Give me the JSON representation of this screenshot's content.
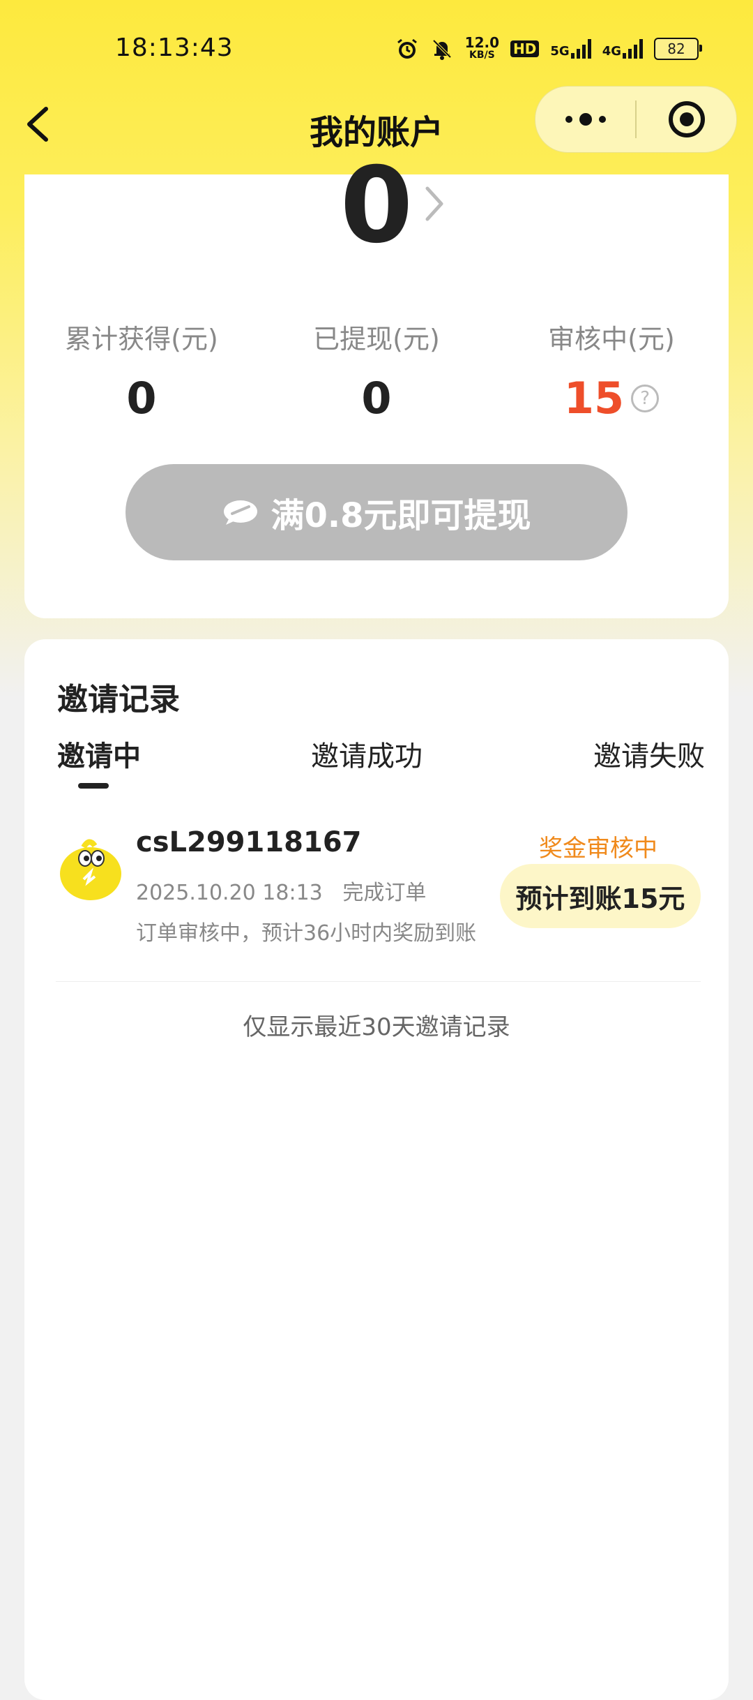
{
  "status_bar": {
    "time": "18:13:43",
    "speed_value": "12.0",
    "speed_unit": "KB/S",
    "hd_label": "HD",
    "net1": "5G",
    "net2": "4G",
    "battery": "82",
    "icons": [
      "alarm-icon",
      "mute-bell-icon",
      "signal-icon",
      "battery-icon"
    ]
  },
  "nav": {
    "title": "我的账户",
    "back_icon": "chevron-left-icon",
    "more_icon": "more-dots-icon",
    "close_icon": "target-icon"
  },
  "account": {
    "balance": "0",
    "stats": [
      {
        "label": "累计获得(元)",
        "value": "0"
      },
      {
        "label": "已提现(元)",
        "value": "0"
      },
      {
        "label": "审核中(元)",
        "value": "15"
      }
    ],
    "help_icon_text": "?",
    "withdraw_label": "满0.8元即可提现",
    "colors": {
      "pending": "#ee4e2a",
      "button_disabled": "#bababa"
    }
  },
  "invites": {
    "section_title": "邀请记录",
    "tabs": [
      {
        "label": "邀请中",
        "active": true
      },
      {
        "label": "邀请成功",
        "active": false
      },
      {
        "label": "邀请失败",
        "active": false
      }
    ],
    "records": [
      {
        "username": "csL299118167",
        "date": "2025.10.20 18:13",
        "action": "完成订单",
        "note": "订单审核中，预计36小时内奖励到账",
        "status": "奖金审核中",
        "eta": "预计到账15元"
      }
    ],
    "footnote": "仅显示最近30天邀请记录"
  }
}
